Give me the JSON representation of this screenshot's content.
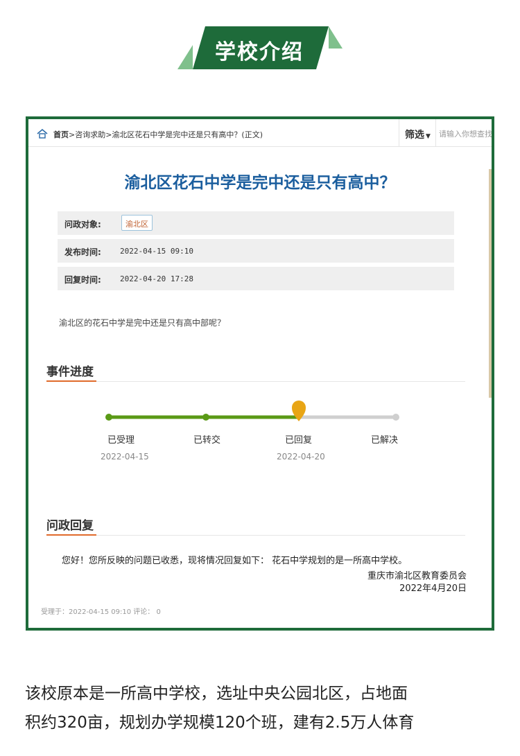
{
  "banner": {
    "title": "学校介绍",
    "color": "#1e6b3a",
    "accent": "#7fc08c"
  },
  "breadcrumb": {
    "home": "首页",
    "sep1": ">",
    "item1": "咨询求助",
    "sep2": ">",
    "item2": "渝北区花石中学是完中还是只有高中？(正文)"
  },
  "toolbar": {
    "filter_label": "筛选",
    "search_placeholder": "请输入你想查找"
  },
  "question": {
    "title": "渝北区花石中学是完中还是只有高中？",
    "target_label": "问政对象:",
    "target_value": "渝北区",
    "publish_label": "发布时间:",
    "publish_value": "2022-04-15 09:10",
    "reply_label": "回复时间:",
    "reply_value": "2022-04-20 17:28",
    "body": "渝北区的花石中学是完中还是只有高中部呢？"
  },
  "progress": {
    "title": "事件进度",
    "current_step": 3,
    "steps": [
      {
        "label": "已受理",
        "date": "2022-04-15"
      },
      {
        "label": "已转交",
        "date": ""
      },
      {
        "label": "已回复",
        "date": "2022-04-20"
      },
      {
        "label": "已解决",
        "date": ""
      }
    ],
    "done_color": "#5a9a16",
    "pending_color": "#cfcfcf",
    "marker_color": "#e8a515"
  },
  "reply": {
    "title": "问政回复",
    "text": "您好！您所反映的问题已收悉，现将情况回复如下： 花石中学规划的是一所高中学校。",
    "org": "重庆市渝北区教育委员会",
    "date": "2022年4月20日"
  },
  "meta": {
    "text": "受理于：2022-04-15 09:10 评论： 0"
  },
  "article": {
    "line1": "该校原本是一所高中学校，选址中央公园北区，占地面",
    "line2": "积约320亩，规划办学规模120个班，建有2.5万人体育"
  }
}
